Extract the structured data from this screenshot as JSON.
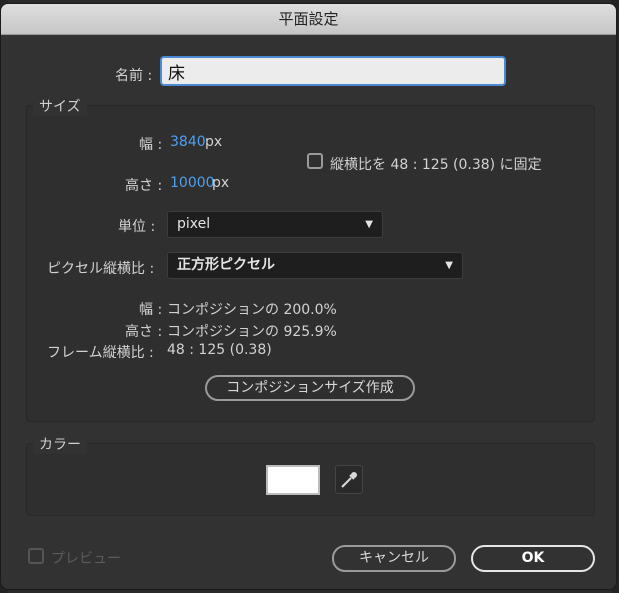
{
  "title": "平面設定",
  "name": {
    "label": "名前 :",
    "value": "床"
  },
  "size_group": {
    "label": "サイズ",
    "width_label": "幅 :",
    "width_value": "3840",
    "width_unit": "px",
    "height_label": "高さ :",
    "height_value": "10000",
    "height_unit": "px",
    "lock_ratio_label": "縦横比を 48 : 125 (0.38) に固定",
    "lock_ratio_checked": false,
    "units_label": "単位 :",
    "units_value": "pixel",
    "pixel_aspect_label": "ピクセル縦横比 :",
    "pixel_aspect_value": "正方形ピクセル",
    "comp_width_label": "幅 :",
    "comp_width_value": "コンポジションの 200.0%",
    "comp_height_label": "高さ :",
    "comp_height_value": "コンポジションの 925.9%",
    "frame_ratio_label": "フレーム縦横比 :",
    "frame_ratio_value": "48 : 125 (0.38)",
    "make_comp_size_button": "コンポジションサイズ作成"
  },
  "color_group": {
    "label": "カラー",
    "swatch_color": "#ffffff",
    "eyedropper_icon": "eyedropper-icon"
  },
  "footer": {
    "preview_label": "プレビュー",
    "preview_checked": false,
    "cancel_button": "キャンセル",
    "ok_button": "OK"
  },
  "colors": {
    "accent_blue": "#4ea0f0",
    "focus_border": "#4b8ad2",
    "dialog_bg": "#323232"
  }
}
